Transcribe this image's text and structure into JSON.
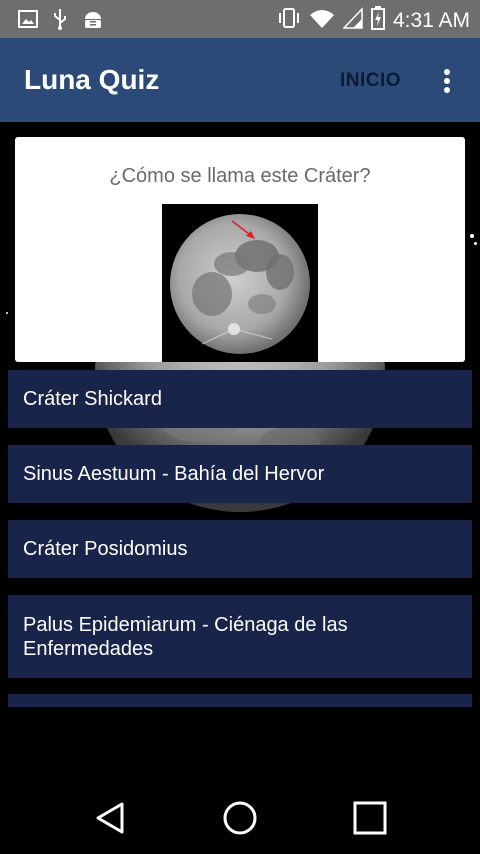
{
  "status_bar": {
    "time": "4:31 AM",
    "icons": [
      "image-icon",
      "usb-icon",
      "android-debug-icon",
      "vibrate-icon",
      "wifi-icon",
      "signal-icon",
      "battery-icon"
    ]
  },
  "app_bar": {
    "title": "Luna Quiz",
    "home_label": "INICIO",
    "overflow_icon": "more-vert-icon"
  },
  "question": {
    "text": "¿Cómo se llama este Cráter?",
    "image": "full-moon-with-red-arrow"
  },
  "answers": [
    {
      "label": "Cráter Shickard"
    },
    {
      "label": "Sinus Aestuum - Bahía del Hervor"
    },
    {
      "label": "Cráter Posidomius"
    },
    {
      "label": "Palus Epidemiarum - Ciénaga de las Enfermedades"
    },
    {
      "label": ""
    }
  ],
  "nav_bar": {
    "icons": [
      "back-icon",
      "home-icon",
      "recents-icon"
    ]
  },
  "colors": {
    "app_bar": "#2b4a78",
    "status_bar": "#6e6e6e",
    "answer_bg": "#19244a",
    "question_text": "#6a6a6a"
  }
}
